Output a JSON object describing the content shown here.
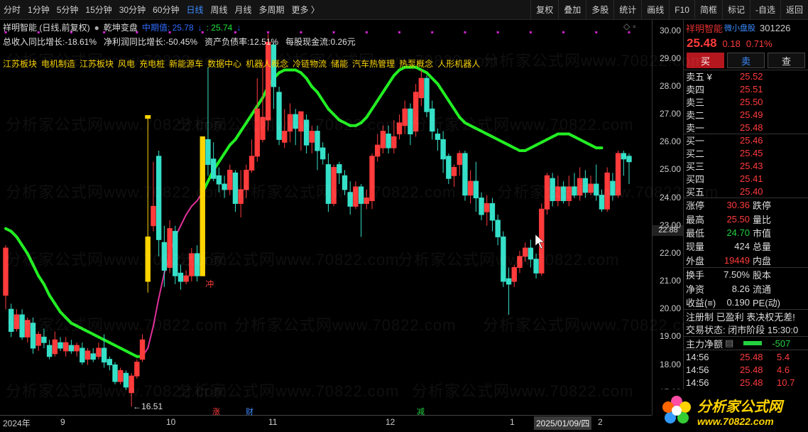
{
  "toolbar": {
    "left_items": [
      "分时",
      "1分钟",
      "5分钟",
      "15分钟",
      "30分钟",
      "60分钟",
      "日线",
      "周线",
      "月线",
      "多周期",
      "更多 〉"
    ],
    "active": "日线",
    "right_items": [
      "复权",
      "叠加",
      "多股",
      "统计",
      "画线",
      "F10",
      "简框",
      "标记",
      "-自选",
      "返回"
    ]
  },
  "header": {
    "stock_title": "祥明智能 (日线,前复权)",
    "indicator_name": "乾坤变盘",
    "indicator_label": "中期值: 25.78",
    "indicator_arrow1": "↓",
    "indicator_value2": ": 25.74",
    "indicator_arrow2": "↓",
    "fundamentals": [
      "总收入同比增长:-18.61%",
      "净利润同比增长:-50.45%",
      "资产负债率:12.51%",
      "每股现金流:0.26元"
    ],
    "concepts": [
      "江苏板块",
      "电机制造",
      "江苏板块",
      "风电",
      "充电桩",
      "新能源车",
      "数据中心",
      "机器人概念",
      "冷链物流",
      "储能",
      "汽车热管理",
      "热泵概念",
      "人形机器人"
    ]
  },
  "price_axis": {
    "labels": [
      "30.00",
      "29.00",
      "28.00",
      "27.00",
      "26.00",
      "25.00",
      "24.00",
      "23.00",
      "22.00",
      "21.00",
      "20.00",
      "19.00",
      "18.00",
      "17.00"
    ],
    "current_marker": "22.88"
  },
  "time_axis": {
    "labels": [
      "2024年",
      "9",
      "10",
      "11",
      "12",
      "1",
      "2"
    ],
    "hover_date": "2025/01/09/四"
  },
  "annotations": {
    "low_label": "←16.51",
    "chong_label": "冲",
    "event_tags": [
      "涨",
      "财",
      "减"
    ]
  },
  "watermark": "分析家公式网www.70822.com",
  "chart_data": {
    "type": "candlestick",
    "ylim": [
      16.2,
      30.4
    ],
    "candles": [
      [
        20.5,
        22.2,
        22.3,
        20.0
      ],
      [
        20.0,
        19.2,
        20.2,
        19.0
      ],
      [
        19.3,
        19.8,
        20.0,
        19.2
      ],
      [
        19.8,
        19.0,
        20.0,
        18.9
      ],
      [
        19.0,
        19.6,
        19.7,
        18.8
      ],
      [
        19.5,
        18.6,
        19.7,
        18.4
      ],
      [
        18.7,
        19.1,
        19.2,
        18.5
      ],
      [
        19.0,
        18.8,
        19.3,
        18.6
      ],
      [
        18.7,
        18.3,
        18.9,
        18.2
      ],
      [
        18.4,
        18.9,
        19.2,
        18.3
      ],
      [
        18.8,
        18.6,
        19.0,
        18.5
      ],
      [
        18.5,
        18.8,
        19.0,
        18.3
      ],
      [
        18.7,
        18.5,
        18.9,
        18.4
      ],
      [
        18.5,
        18.7,
        18.8,
        18.3
      ],
      [
        18.6,
        18.1,
        18.8,
        18.0
      ],
      [
        18.2,
        18.5,
        18.6,
        18.0
      ],
      [
        18.4,
        18.2,
        18.6,
        18.1
      ],
      [
        18.3,
        18.6,
        18.8,
        18.2
      ],
      [
        18.6,
        18.1,
        19.1,
        17.9
      ],
      [
        18.2,
        18.0,
        18.3,
        17.8
      ],
      [
        18.0,
        17.4,
        18.1,
        17.3
      ],
      [
        17.4,
        17.8,
        17.9,
        17.3
      ],
      [
        17.7,
        17.2,
        17.8,
        17.1
      ],
      [
        17.0,
        17.6,
        17.7,
        16.5
      ],
      [
        17.6,
        18.1,
        18.2,
        17.5
      ],
      [
        18.2,
        18.9,
        19.1,
        18.1
      ],
      [
        21.0,
        22.6,
        26.9,
        20.6
      ],
      [
        23.0,
        23.7,
        25.3,
        22.8
      ],
      [
        25.5,
        22.5,
        25.7,
        21.9
      ],
      [
        22.4,
        21.4,
        23.0,
        20.8
      ],
      [
        21.5,
        22.9,
        23.2,
        21.3
      ],
      [
        22.8,
        21.2,
        23.0,
        20.9
      ],
      [
        21.3,
        21.0,
        21.6,
        20.7
      ],
      [
        21.0,
        21.2,
        21.4,
        20.9
      ],
      [
        21.2,
        22.0,
        22.2,
        21.0
      ],
      [
        22.0,
        21.2,
        22.3,
        21.0
      ],
      [
        21.2,
        26.2,
        26.2,
        21.2
      ],
      [
        26.1,
        25.2,
        28.7,
        24.8
      ],
      [
        25.4,
        24.7,
        26.0,
        24.6
      ],
      [
        24.8,
        24.5,
        25.1,
        24.2
      ],
      [
        24.5,
        24.3,
        24.8,
        24.0
      ],
      [
        24.3,
        25.0,
        25.2,
        24.1
      ],
      [
        24.9,
        23.8,
        25.0,
        23.5
      ],
      [
        23.8,
        24.3,
        25.0,
        23.3
      ],
      [
        24.3,
        25.0,
        25.2,
        24.0
      ],
      [
        25.0,
        25.5,
        26.1,
        24.9
      ],
      [
        25.5,
        27.2,
        28.3,
        25.3
      ],
      [
        26.1,
        26.9,
        28.9,
        26.0
      ],
      [
        26.8,
        29.6,
        29.9,
        26.4
      ],
      [
        29.5,
        28.0,
        29.6,
        27.2
      ],
      [
        27.8,
        26.1,
        28.0,
        25.9
      ],
      [
        26.0,
        26.4,
        27.2,
        25.8
      ],
      [
        26.4,
        27.0,
        27.4,
        26.0
      ],
      [
        27.0,
        26.5,
        27.2,
        25.9
      ],
      [
        26.4,
        27.1,
        27.1,
        25.7
      ],
      [
        26.8,
        25.9,
        27.0,
        25.6
      ],
      [
        26.0,
        26.4,
        26.6,
        25.6
      ],
      [
        26.4,
        25.7,
        26.6,
        25.0
      ],
      [
        25.8,
        25.4,
        26.0,
        25.2
      ],
      [
        25.2,
        23.8,
        25.6,
        23.5
      ],
      [
        23.8,
        25.1,
        25.2,
        23.7
      ],
      [
        25.2,
        24.9,
        25.3,
        24.5
      ],
      [
        24.8,
        24.3,
        25.0,
        24.1
      ],
      [
        24.2,
        23.7,
        24.6,
        23.4
      ],
      [
        23.7,
        24.4,
        24.6,
        23.6
      ],
      [
        24.4,
        23.8,
        24.5,
        22.6
      ],
      [
        23.8,
        24.0,
        24.3,
        23.6
      ],
      [
        23.9,
        25.5,
        25.6,
        23.6
      ],
      [
        25.5,
        25.9,
        26.3,
        25.3
      ],
      [
        25.8,
        26.4,
        26.6,
        25.6
      ],
      [
        26.3,
        25.8,
        26.6,
        25.6
      ],
      [
        25.8,
        26.2,
        26.8,
        25.6
      ],
      [
        26.3,
        26.7,
        27.0,
        26.1
      ],
      [
        26.6,
        27.2,
        27.5,
        26.3
      ],
      [
        27.2,
        26.3,
        27.4,
        25.9
      ],
      [
        26.4,
        27.8,
        28.1,
        26.2
      ],
      [
        27.6,
        28.3,
        28.6,
        27.3
      ],
      [
        28.3,
        27.1,
        28.4,
        26.9
      ],
      [
        27.2,
        26.4,
        27.5,
        26.1
      ],
      [
        26.3,
        26.1,
        26.5,
        25.7
      ],
      [
        26.1,
        25.4,
        26.4,
        24.9
      ],
      [
        25.5,
        24.7,
        25.6,
        24.5
      ],
      [
        24.8,
        25.1,
        25.2,
        24.4
      ],
      [
        25.2,
        25.6,
        25.7,
        24.8
      ],
      [
        25.6,
        24.1,
        25.7,
        23.9
      ],
      [
        24.1,
        24.6,
        25.0,
        23.8
      ],
      [
        24.6,
        24.0,
        25.3,
        23.5
      ],
      [
        24.0,
        23.4,
        24.2,
        23.2
      ],
      [
        23.5,
        23.8,
        24.1,
        23.0
      ],
      [
        23.8,
        23.2,
        24.0,
        22.8
      ],
      [
        23.2,
        22.6,
        23.4,
        22.3
      ],
      [
        22.6,
        21.0,
        22.8,
        20.8
      ],
      [
        21.1,
        20.9,
        21.5,
        19.8
      ],
      [
        21.0,
        21.5,
        21.6,
        20.8
      ],
      [
        21.5,
        21.9,
        22.1,
        21.3
      ],
      [
        21.9,
        22.2,
        22.4,
        21.7
      ],
      [
        22.2,
        21.8,
        22.5,
        21.5
      ],
      [
        21.8,
        21.3,
        22.0,
        21.1
      ],
      [
        21.3,
        23.6,
        23.8,
        21.2
      ],
      [
        23.6,
        24.8,
        24.9,
        23.4
      ],
      [
        24.7,
        23.9,
        24.9,
        23.7
      ],
      [
        23.9,
        24.4,
        24.8,
        23.7
      ],
      [
        24.4,
        23.9,
        24.6,
        23.8
      ],
      [
        23.9,
        24.4,
        24.8,
        23.7
      ],
      [
        24.4,
        24.1,
        24.9,
        24.0
      ],
      [
        24.1,
        24.7,
        25.1,
        23.9
      ],
      [
        24.7,
        24.2,
        25.0,
        24.0
      ],
      [
        24.2,
        24.5,
        24.8,
        24.1
      ],
      [
        24.5,
        24.1,
        25.2,
        23.9
      ],
      [
        24.1,
        23.6,
        24.3,
        23.5
      ],
      [
        23.6,
        24.9,
        25.1,
        23.5
      ],
      [
        24.6,
        24.1,
        24.9,
        23.9
      ],
      [
        24.1,
        25.6,
        25.7,
        24.0
      ],
      [
        25.6,
        25.4,
        25.7,
        24.8
      ],
      [
        25.5,
        25.3,
        25.6,
        24.5
      ]
    ],
    "ma_line": [
      22.9,
      22.8,
      22.6,
      22.3,
      22.0,
      21.6,
      21.2,
      20.9,
      20.5,
      20.2,
      19.9,
      19.7,
      19.5,
      19.4,
      19.3,
      19.2,
      19.1,
      19.0,
      18.9,
      18.8,
      18.7,
      18.6,
      18.5,
      18.4,
      18.3,
      18.3,
      18.6,
      19.4,
      20.4,
      21.3,
      22.0,
      22.6,
      23.0,
      23.4,
      23.7,
      23.9,
      24.2,
      24.6,
      25.0,
      25.3,
      25.6,
      25.9,
      26.1,
      26.4,
      26.7,
      27.0,
      27.3,
      27.6,
      28.0,
      28.3,
      28.5,
      28.6,
      28.6,
      28.6,
      28.5,
      28.3,
      28.0,
      27.8,
      27.5,
      27.2,
      27.0,
      26.8,
      26.7,
      26.6,
      26.6,
      26.7,
      26.9,
      27.2,
      27.5,
      27.8,
      28.1,
      28.4,
      28.6,
      28.7,
      28.7,
      28.7,
      28.6,
      28.5,
      28.3,
      28.1,
      27.8,
      27.5,
      27.2,
      26.9,
      26.7,
      26.6,
      26.5,
      26.4,
      26.3,
      26.2,
      26.1,
      26.0,
      25.9,
      25.8,
      25.7,
      25.7,
      25.8,
      25.9,
      26.0,
      26.1,
      26.2,
      26.3,
      26.3,
      26.3,
      26.2,
      26.1,
      26.0,
      25.9,
      25.8,
      25.8
    ]
  },
  "right_panel": {
    "name": "祥明智能",
    "tag": "微小盘股",
    "code": "301226",
    "price": "25.48",
    "change": "0.18",
    "change_pct": "0.71%",
    "buttons": {
      "buy": "买",
      "sell": "卖",
      "query": "查"
    },
    "sells": [
      {
        "label": "卖五 ¥",
        "price": "25.52"
      },
      {
        "label": "卖四",
        "price": "25.51"
      },
      {
        "label": "卖三",
        "price": "25.50"
      },
      {
        "label": "卖二",
        "price": "25.49"
      },
      {
        "label": "卖一",
        "price": "25.48"
      }
    ],
    "buys": [
      {
        "label": "买一",
        "price": "25.46"
      },
      {
        "label": "买二",
        "price": "25.45"
      },
      {
        "label": "买三",
        "price": "25.43"
      },
      {
        "label": "买四",
        "price": "25.41"
      },
      {
        "label": "买五",
        "price": "25.40"
      }
    ],
    "stats1": [
      {
        "l": "涨停",
        "v": "30.36",
        "c": "red",
        "l2": "跌停"
      },
      {
        "l": "最高",
        "v": "25.50",
        "c": "red",
        "l2": "量比"
      },
      {
        "l": "最低",
        "v": "24.70",
        "c": "green",
        "l2": "市值"
      },
      {
        "l": "现量",
        "v": "424",
        "c": "white",
        "l2": "总量"
      },
      {
        "l": "外盘",
        "v": "19449",
        "c": "red",
        "l2": "内盘"
      }
    ],
    "stats2": [
      {
        "l": "换手",
        "v": "7.50%",
        "c": "white",
        "l2": "股本"
      },
      {
        "l": "净资",
        "v": "8.26",
        "c": "white",
        "l2": "流通"
      },
      {
        "l": "收益(≡)",
        "v": "0.190",
        "c": "white",
        "l2": "PE(动)"
      }
    ],
    "reg_line": "注册制 已盈利 表决权无差!",
    "trade_status": "交易状态: 闭市阶段 15:30:0",
    "main_flow_label": "主力净额",
    "main_flow_value": "-507",
    "ticks": [
      {
        "t": "14:56",
        "p": "25.48",
        "v": "5.4"
      },
      {
        "t": "14:56",
        "p": "25.48",
        "v": "4.6"
      },
      {
        "t": "14:56",
        "p": "25.48",
        "v": "10.7"
      }
    ]
  },
  "logo": {
    "cn": "分析家公式网",
    "url": "www.70822.com"
  },
  "colors": {
    "up": "#ff3b3b",
    "down": "#35e0c8",
    "ma": "#22ee22",
    "ma_rise": "#e0309a",
    "accent": "#3b8cff",
    "limit_up": "#ffd400"
  }
}
